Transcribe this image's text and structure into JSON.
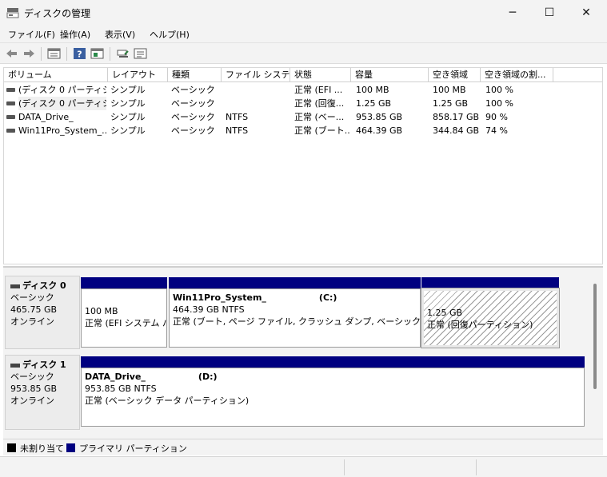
{
  "window": {
    "title": "ディスクの管理"
  },
  "window_controls": {
    "minimize": "─",
    "maximize": "☐",
    "close": "✕"
  },
  "menu": [
    "ファイル(F)",
    "操作(A)",
    "表示(V)",
    "ヘルプ(H)"
  ],
  "toolbar": {
    "icons": [
      "back-arrow-icon",
      "forward-arrow-icon",
      "properties-icon",
      "help-icon",
      "console-icon",
      "connect-icon",
      "view-icon"
    ]
  },
  "columns": [
    "ボリューム",
    "レイアウト",
    "種類",
    "ファイル システム",
    "状態",
    "容量",
    "空き領域",
    "空き領域の割..."
  ],
  "volumes": [
    [
      "(ディスク 0 パーティシ...",
      "シンプル",
      "ベーシック",
      "",
      "正常 (EFI ...",
      "100 MB",
      "100 MB",
      "100 %"
    ],
    [
      "(ディスク 0 パーティシ...",
      "シンプル",
      "ベーシック",
      "",
      "正常 (回復...",
      "1.25 GB",
      "1.25 GB",
      "100 %"
    ],
    [
      "DATA_Drive_",
      "シンプル",
      "ベーシック",
      "NTFS",
      "正常 (ベー...",
      "953.85 GB",
      "858.17 GB",
      "90 %"
    ],
    [
      "Win11Pro_System_...",
      "シンプル",
      "ベーシック",
      "NTFS",
      "正常 (ブート...",
      "464.39 GB",
      "344.84 GB",
      "74 %"
    ]
  ],
  "disk0": {
    "name": "ディスク 0",
    "type": "ベーシック",
    "size": "465.75 GB",
    "status": "オンライン",
    "partitions": [
      {
        "name": "",
        "letter": "",
        "size": "100 MB",
        "status": "正常 (EFI システム パ"
      },
      {
        "name": "Win11Pro_System_",
        "letter": "(C:)",
        "size": "464.39 GB NTFS",
        "status": "正常 (ブート, ページ ファイル, クラッシュ ダンプ, ベーシック データ パ"
      },
      {
        "name": "",
        "letter": "",
        "size": "1.25 GB",
        "status": "正常 (回復パーティション)"
      }
    ]
  },
  "disk1": {
    "name": "ディスク 1",
    "type": "ベーシック",
    "size": "953.85 GB",
    "status": "オンライン",
    "partitions": [
      {
        "name": "DATA_Drive_",
        "letter": "(D:)",
        "size": "953.85 GB NTFS",
        "status": "正常 (ベーシック データ パーティション)"
      }
    ]
  },
  "legend": {
    "unallocated": "未割り当て",
    "primary": "プライマリ パーティション"
  },
  "colors": {
    "unallocated": "#000000",
    "primary": "#000080"
  }
}
